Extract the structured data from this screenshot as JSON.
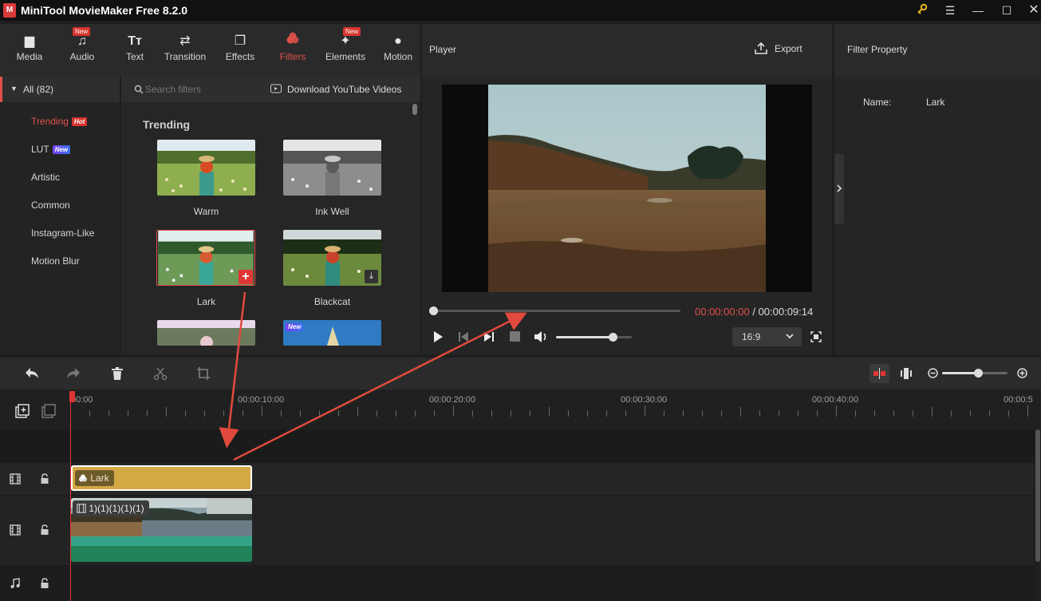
{
  "app": {
    "title": "MiniTool MovieMaker Free 8.2.0",
    "logo_icon": "moviemaker-logo-icon"
  },
  "window_controls": {
    "icons": [
      "key-icon",
      "menu-icon",
      "minimize-icon",
      "maximize-icon",
      "close-icon"
    ]
  },
  "toolbar": {
    "items": [
      {
        "label": "Media",
        "icon": "folder-icon",
        "badge": ""
      },
      {
        "label": "Audio",
        "icon": "music-note-icon",
        "badge": "New"
      },
      {
        "label": "Text",
        "icon": "text-icon",
        "badge": ""
      },
      {
        "label": "Transition",
        "icon": "swap-arrows-icon",
        "badge": ""
      },
      {
        "label": "Effects",
        "icon": "layers-icon",
        "badge": ""
      },
      {
        "label": "Filters",
        "icon": "filters-icon",
        "badge": ""
      },
      {
        "label": "Elements",
        "icon": "elements-icon",
        "badge": "New"
      },
      {
        "label": "Motion",
        "icon": "motion-icon",
        "badge": ""
      }
    ],
    "active": "Filters"
  },
  "categories": {
    "all_label": "All (82)",
    "items": [
      {
        "label": "Trending",
        "tag": "Hot",
        "active": true
      },
      {
        "label": "LUT",
        "tag": "New",
        "active": false
      },
      {
        "label": "Artistic",
        "tag": "",
        "active": false
      },
      {
        "label": "Common",
        "tag": "",
        "active": false
      },
      {
        "label": "Instagram-Like",
        "tag": "",
        "active": false
      },
      {
        "label": "Motion Blur",
        "tag": "",
        "active": false
      }
    ]
  },
  "filters": {
    "search_placeholder": "Search filters",
    "download_label": "Download YouTube Videos",
    "section_title": "Trending",
    "items": [
      {
        "label": "Warm"
      },
      {
        "label": "Ink Well"
      },
      {
        "label": "Lark"
      },
      {
        "label": "Blackcat"
      }
    ],
    "partial_badge": "New"
  },
  "player": {
    "title": "Player",
    "export_label": "Export",
    "current_time": "00:00:00:00",
    "separator": "/",
    "total_time": "00:00:09:14",
    "progress": 0.0,
    "volume": 0.75,
    "aspect_ratio": "16:9"
  },
  "filter_property": {
    "title": "Filter Property",
    "name_label": "Name:",
    "name_value": "Lark"
  },
  "timeline": {
    "ruler_labels": [
      "00:00",
      "00:00:10:00",
      "00:00:20:00",
      "00:00:30:00",
      "00:00:40:00",
      "00:00:5"
    ],
    "zoom": 0.55,
    "filter_clip_label": "Lark",
    "video_clip_label": "1)(1)(1)(1)(1)"
  },
  "colors": {
    "accent": "#e0504a",
    "filter_clip": "#d4a843",
    "video_clip_bar": "#2a9d78"
  }
}
